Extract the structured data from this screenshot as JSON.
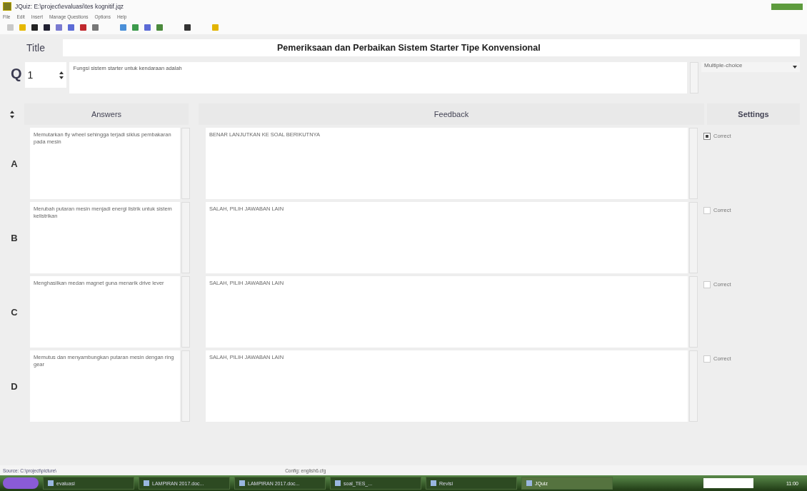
{
  "window": {
    "title": "JQuiz: E:\\project\\evaluasi\\tes kognitif.jqz"
  },
  "menu": [
    "File",
    "Edit",
    "Insert",
    "Manage Questions",
    "Options",
    "Help"
  ],
  "title_label": "Title",
  "title_value": "Pemeriksaan dan Perbaikan Sistem Starter Tipe Konvensional",
  "question": {
    "label": "Q",
    "number": "1",
    "text": "Fungsi sistem starter untuk kendaraan adalah",
    "type": "Multiple-choice"
  },
  "headers": {
    "answers": "Answers",
    "feedback": "Feedback",
    "settings": "Settings"
  },
  "answers": [
    {
      "letter": "A",
      "text": "Memutarkan fly wheel sehingga terjadi siklus pembakaran pada mesin",
      "feedback": "BENAR LANJUTKAN KE SOAL BERIKUTNYA",
      "correct_label": "Correct",
      "checked": true
    },
    {
      "letter": "B",
      "text": "Merubah putaran mesin menjadi energi listrik untuk sistem kelistrikan",
      "feedback": "SALAH, PILIH JAWABAN LAIN",
      "correct_label": "Correct",
      "checked": false
    },
    {
      "letter": "C",
      "text": "Menghasilkan medan magnet guna menarik drive lever",
      "feedback": "SALAH, PILIH JAWABAN LAIN",
      "correct_label": "Correct",
      "checked": false
    },
    {
      "letter": "D",
      "text": "Memutus dan menyambungkan putaran mesin dengan ring gear",
      "feedback": "SALAH, PILIH JAWABAN LAIN",
      "correct_label": "Correct",
      "checked": false
    }
  ],
  "status_bar": {
    "source": "Source: C:\\project\\picture\\",
    "config": "Config: english6.cfg"
  },
  "taskbar": {
    "tasks": [
      {
        "label": "evaluasi",
        "selected": false
      },
      {
        "label": "LAMPIRAN 2017.doc...",
        "selected": false
      },
      {
        "label": "LAMPIRAN 2017.doc...",
        "selected": false
      },
      {
        "label": "soal_TES_...",
        "selected": false
      },
      {
        "label": "Revisi",
        "selected": false
      },
      {
        "label": "JQuiz",
        "selected": true
      }
    ],
    "clock": "11:00"
  }
}
